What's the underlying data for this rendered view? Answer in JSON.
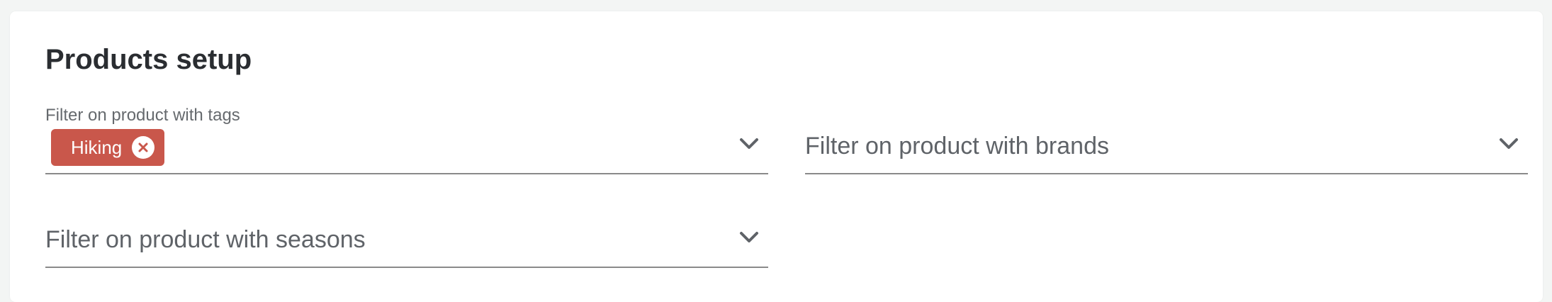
{
  "page": {
    "title": "Products setup"
  },
  "filters": {
    "tags": {
      "label": "Filter on product with tags",
      "chips": [
        {
          "label": "Hiking"
        }
      ]
    },
    "brands": {
      "placeholder": "Filter on product with brands"
    },
    "seasons": {
      "placeholder": "Filter on product with seasons"
    }
  },
  "colors": {
    "chip_background": "#c9574b",
    "text_primary": "#2a2d31",
    "text_secondary": "#5f6368",
    "underline": "#8a8a8a",
    "page_background": "#f3f5f4"
  },
  "icons": {
    "dropdown": "chevron-down-icon",
    "chip_remove": "close-circle-icon"
  }
}
